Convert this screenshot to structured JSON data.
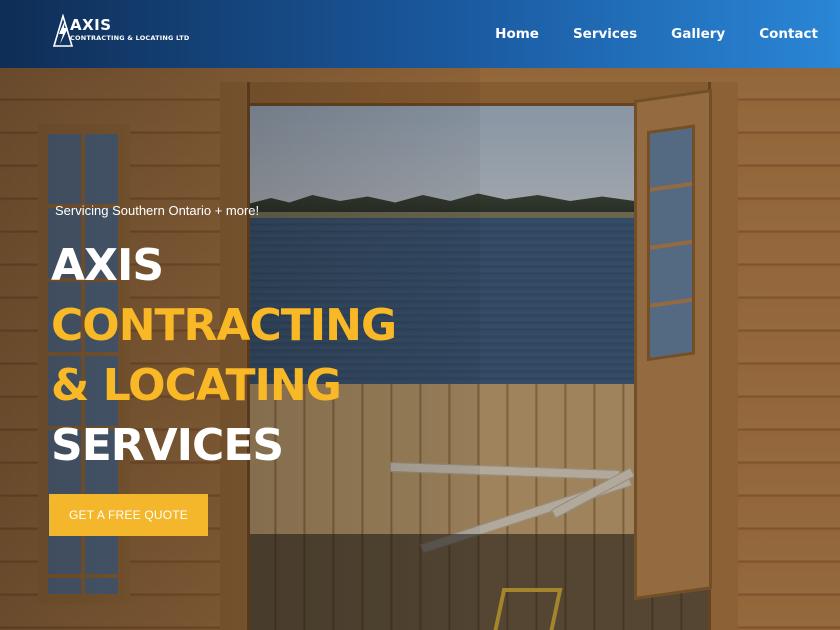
{
  "header": {
    "logo_title": "AXIS",
    "logo_subtitle": "CONTRACTING & LOCATING LTD",
    "nav": [
      {
        "label": "Home"
      },
      {
        "label": "Services"
      },
      {
        "label": "Gallery"
      },
      {
        "label": "Contact"
      }
    ]
  },
  "hero": {
    "tagline": "Servicing Southern Ontario + more!",
    "headline": [
      "AXIS",
      "CONTRACTING",
      "& LOCATING",
      "SERVICES"
    ],
    "cta_label": "GET A FREE QUOTE"
  },
  "colors": {
    "accent_yellow": "#f9b825",
    "button_yellow": "#f4b62a",
    "header_dark": "#0f2d55",
    "header_light": "#2a86d6"
  },
  "icons": {
    "logo_mark": "lightning-triangle-icon"
  }
}
